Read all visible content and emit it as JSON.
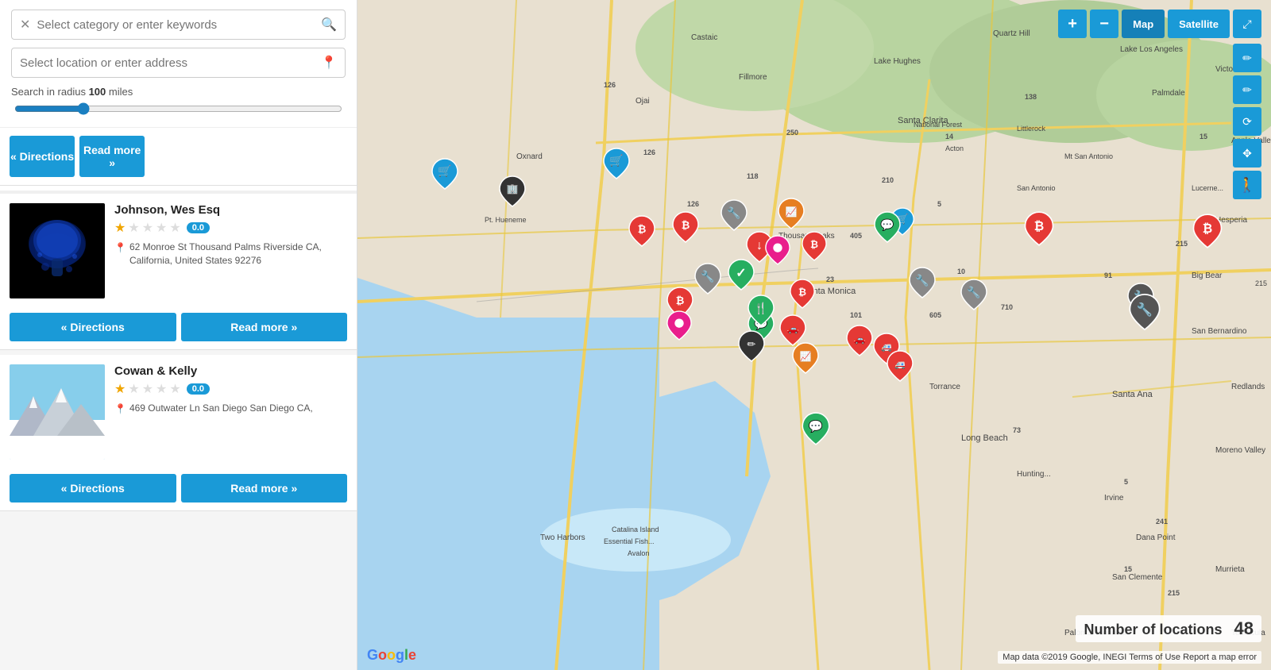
{
  "search": {
    "keyword_placeholder": "Select category or enter keywords",
    "location_placeholder": "Select location or enter address",
    "radius_label": "Search in radius",
    "radius_value": "100",
    "radius_unit": "miles"
  },
  "listings": [
    {
      "id": 1,
      "name": null,
      "address": null,
      "rating": 0,
      "has_image": false,
      "directions_label": "« Directions",
      "readmore_label": "Read more »"
    },
    {
      "id": 2,
      "name": "Johnson, Wes Esq",
      "address": "62 Monroe St Thousand Palms Riverside CA, California, United States 92276",
      "rating": 0.0,
      "rating_display": "0.0",
      "has_image": true,
      "image_type": "mushroom",
      "directions_label": "« Directions",
      "readmore_label": "Read more »"
    },
    {
      "id": 3,
      "name": "Cowan & Kelly",
      "address": "469 Outwater Ln San Diego San Diego CA,",
      "rating": 0.0,
      "rating_display": "0.0",
      "has_image": true,
      "image_type": "mountain",
      "directions_label": "« Directions",
      "readmore_label": "Read more »"
    }
  ],
  "map": {
    "zoom_in_label": "+",
    "zoom_out_label": "−",
    "map_label": "Map",
    "satellite_label": "Satellite",
    "locations_count_label": "Number of locations",
    "locations_count": "48",
    "attribution": "Map data ©2019 Google, INEGI  Terms of Use  Report a map error",
    "google_label": "Google"
  },
  "icons": {
    "close": "✕",
    "search": "🔍",
    "location": "📍",
    "address": "📍",
    "expand": "⤢",
    "edit": "✏",
    "refresh": "⟳",
    "move": "✥",
    "person": "🚶"
  }
}
